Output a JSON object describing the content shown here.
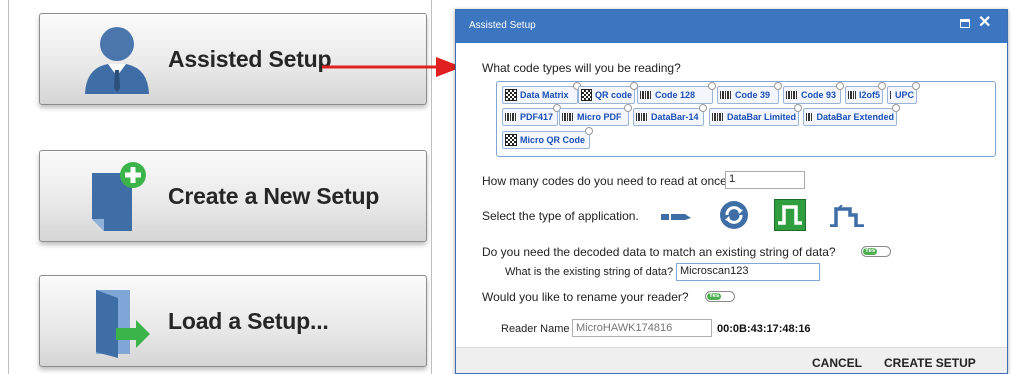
{
  "left_panel": {
    "buttons": [
      {
        "label": "Assisted Setup",
        "icon": "person-icon"
      },
      {
        "label": "Create a New Setup",
        "icon": "new-document-icon"
      },
      {
        "label": "Load a Setup...",
        "icon": "open-door-icon"
      }
    ]
  },
  "dialog": {
    "title": "Assisted Setup",
    "q_code_types": "What code types will you be reading?",
    "code_types": [
      {
        "label": "Data Matrix",
        "icon": "qr"
      },
      {
        "label": "QR code",
        "icon": "qr"
      },
      {
        "label": "Code 128",
        "icon": "barcode"
      },
      {
        "label": "Code 39",
        "icon": "barcode"
      },
      {
        "label": "Code 93",
        "icon": "barcode"
      },
      {
        "label": "I2of5",
        "icon": "barcode"
      },
      {
        "label": "UPC",
        "icon": "barcode"
      },
      {
        "label": "PDF417",
        "icon": "barcode"
      },
      {
        "label": "Micro PDF",
        "icon": "barcode"
      },
      {
        "label": "DataBar-14",
        "icon": "barcode"
      },
      {
        "label": "DataBar Limited",
        "icon": "barcode"
      },
      {
        "label": "DataBar Extended",
        "icon": "barcode"
      },
      {
        "label": "Micro QR Code",
        "icon": "qr"
      }
    ],
    "q_how_many": "How many codes do you need to read at once?",
    "how_many_value": "1",
    "q_app_type": "Select the type of application.",
    "q_match": "Do you need the decoded data to match an existing string of data?",
    "q_existing": "What is the existing string of data?",
    "existing_value": "Microscan123",
    "q_rename": "Would you like to rename your reader?",
    "toggle_label": "Yes",
    "reader_name_label": "Reader Name",
    "reader_name_placeholder": "MicroHAWK174816",
    "mac_address": "00:0B:43:17:48:16",
    "cancel_label": "CANCEL",
    "create_label": "CREATE SETUP"
  },
  "colors": {
    "title_bar": "#3d76c0",
    "chip_text": "#1c4fb8",
    "arrow": "#e02020",
    "toggle_on": "#4caf50",
    "selected_app": "#2e9e3e"
  }
}
